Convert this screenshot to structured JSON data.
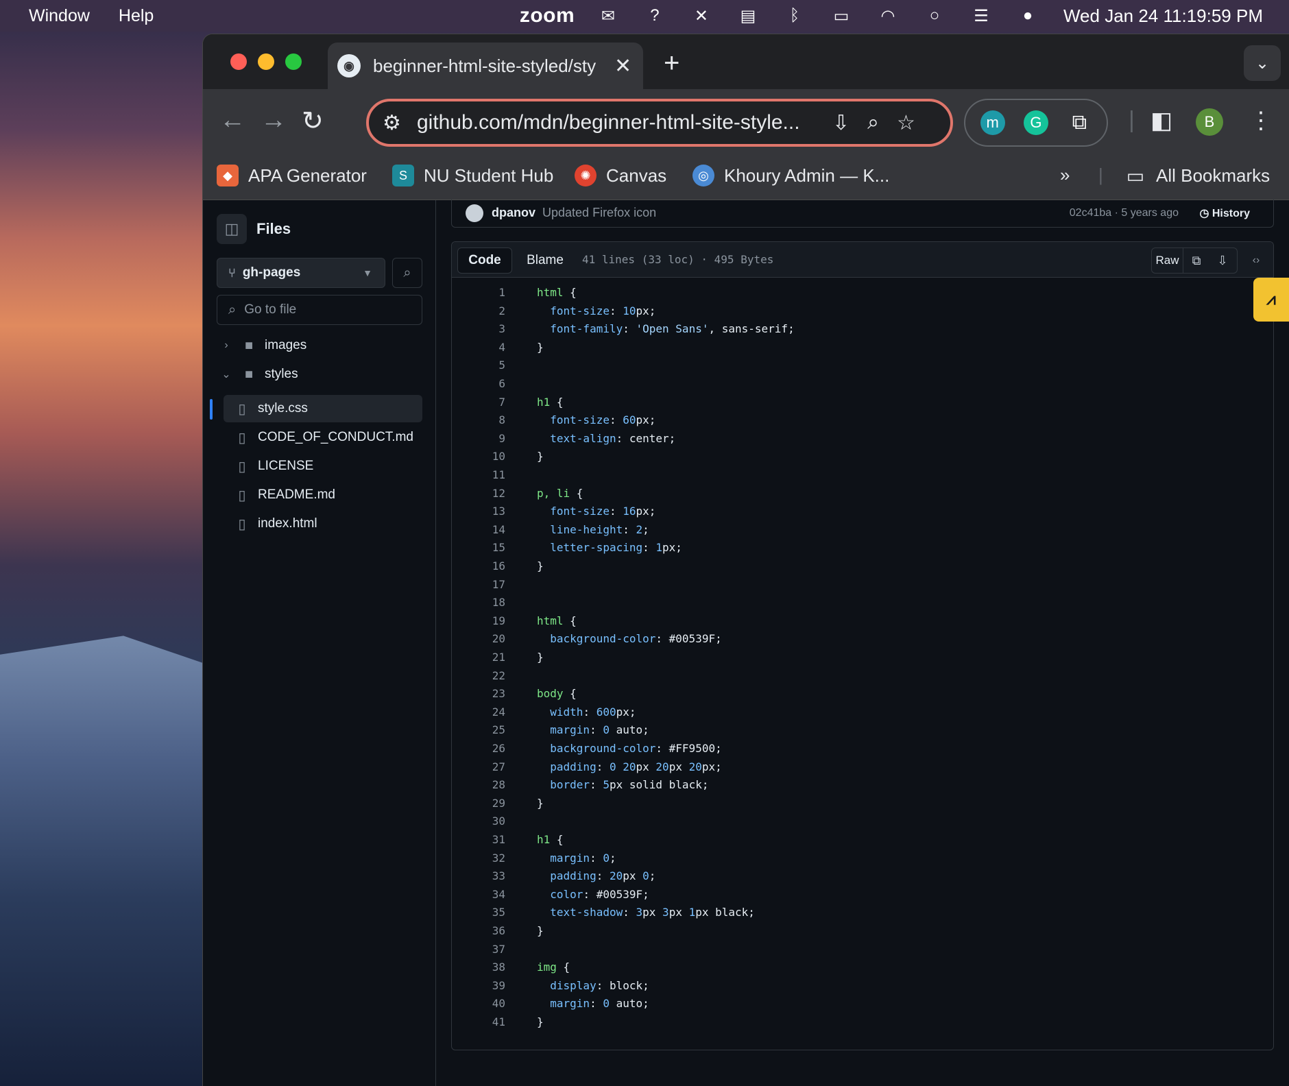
{
  "menubar": {
    "window": "Window",
    "help": "Help",
    "zoom": "zoom",
    "clock": "Wed Jan 24  11:19:59 PM"
  },
  "browser": {
    "tab_title": "beginner-html-site-styled/sty",
    "url": "github.com/mdn/beginner-html-site-style...",
    "profile_initial": "B",
    "extension_m": "m",
    "bookmarks": [
      {
        "label": "APA Generator",
        "icon": "apa-icon",
        "color": "#e8663c"
      },
      {
        "label": "NU Student Hub",
        "icon": "sharepoint-icon",
        "color": "#1e8a9a"
      },
      {
        "label": "Canvas",
        "icon": "canvas-icon",
        "color": "#e0432f"
      },
      {
        "label": "Khoury Admin — K...",
        "icon": "khoury-icon",
        "color": "#4a8ad4"
      }
    ],
    "all_bookmarks": "All Bookmarks"
  },
  "sidebar": {
    "title": "Files",
    "branch": "gh-pages",
    "go_to_file": "Go to file",
    "tree": [
      {
        "label": "images",
        "type": "folder",
        "expanded": false
      },
      {
        "label": "styles",
        "type": "folder",
        "expanded": true
      },
      {
        "label": "style.css",
        "type": "file",
        "selected": true
      },
      {
        "label": "CODE_OF_CONDUCT.md",
        "type": "file"
      },
      {
        "label": "LICENSE",
        "type": "file"
      },
      {
        "label": "README.md",
        "type": "file"
      },
      {
        "label": "index.html",
        "type": "file"
      }
    ]
  },
  "commit": {
    "user": "dpanov",
    "message": "Updated Firefox icon",
    "sha_age": "02c41ba · 5 years ago",
    "history": "History"
  },
  "file": {
    "tab_code": "Code",
    "tab_blame": "Blame",
    "meta": "41 lines (33 loc) · 495 Bytes",
    "raw": "Raw"
  },
  "code_lines": [
    "html {",
    "  font-size: 10px;",
    "  font-family: 'Open Sans', sans-serif;",
    "}",
    "",
    "",
    "h1 {",
    "  font-size: 60px;",
    "  text-align: center;",
    "}",
    "",
    "p, li {",
    "  font-size: 16px;",
    "  line-height: 2;",
    "  letter-spacing: 1px;",
    "}",
    "",
    "",
    "html {",
    "  background-color: #00539F;",
    "}",
    "",
    "body {",
    "  width: 600px;",
    "  margin: 0 auto;",
    "  background-color: #FF9500;",
    "  padding: 0 20px 20px 20px;",
    "  border: 5px solid black;",
    "}",
    "",
    "h1 {",
    "  margin: 0;",
    "  padding: 20px 0;",
    "  color: #00539F;",
    "  text-shadow: 3px 3px 1px black;",
    "}",
    "",
    "img {",
    "  display: block;",
    "  margin: 0 auto;",
    "}"
  ]
}
